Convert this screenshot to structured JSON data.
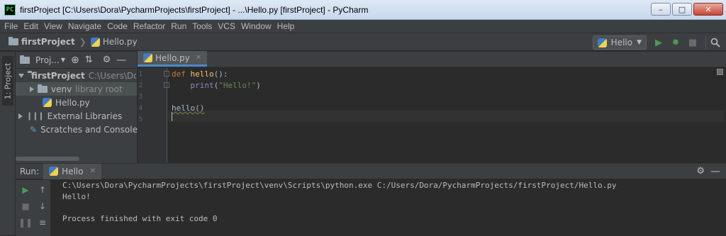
{
  "window": {
    "title": "firstProject [C:\\Users\\Dora\\PycharmProjects\\firstProject] - ...\\Hello.py [firstProject] - PyCharm",
    "app_icon": "PC"
  },
  "menu": [
    "File",
    "Edit",
    "View",
    "Navigate",
    "Code",
    "Refactor",
    "Run",
    "Tools",
    "VCS",
    "Window",
    "Help"
  ],
  "breadcrumbs": {
    "project": "firstProject",
    "file": "Hello.py"
  },
  "run_config": {
    "label": "Hello"
  },
  "sidebar_tab": "1: Project",
  "project_panel": {
    "title": "Proj...",
    "tree": [
      {
        "label": "firstProject",
        "hint": "C:\\Users\\Dora\\",
        "level": 0,
        "expanded": true,
        "icon": "folder-icon"
      },
      {
        "label": "venv",
        "hint": "library root",
        "level": 1,
        "expanded": false,
        "icon": "folder-icon"
      },
      {
        "label": "Hello.py",
        "hint": "",
        "level": 1,
        "icon": "python-file-icon"
      },
      {
        "label": "External Libraries",
        "hint": "",
        "level": 0,
        "expanded": false,
        "icon": "libraries-icon"
      },
      {
        "label": "Scratches and Consoles",
        "hint": "",
        "level": 0,
        "icon": "scratches-icon"
      }
    ]
  },
  "editor": {
    "tab": "Hello.py",
    "line_numbers": [
      "1",
      "2",
      "3",
      "4",
      "5"
    ],
    "code": {
      "l1_kw": "def",
      "l1_fn": "hello",
      "l1_rest": "():",
      "l2_indent": "    ",
      "l2_bi": "print",
      "l2_open": "(",
      "l2_str": "\"Hello!\"",
      "l2_close": ")",
      "l4": "hello()"
    }
  },
  "run": {
    "label": "Run:",
    "tab": "Hello",
    "output": [
      "C:\\Users\\Dora\\PycharmProjects\\firstProject\\venv\\Scripts\\python.exe C:/Users/Dora/PycharmProjects/firstProject/Hello.py",
      "Hello!",
      "",
      "Process finished with exit code 0"
    ]
  },
  "colors": {
    "keyword": "#cc7832",
    "function": "#ffc66d",
    "string": "#6a8759",
    "run_green": "#499c54"
  }
}
